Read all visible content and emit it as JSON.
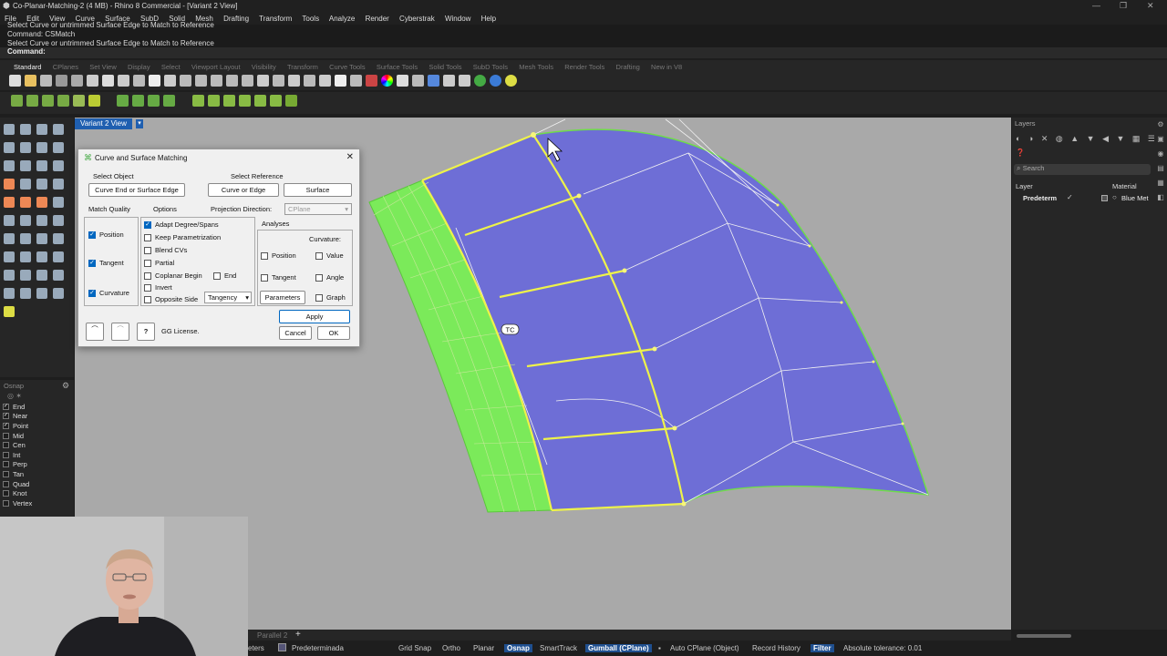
{
  "window": {
    "title": "Co-Planar-Matching-2 (4 MB) - Rhino 8 Commercial - [Variant 2 View]"
  },
  "menu": [
    "File",
    "Edit",
    "View",
    "Curve",
    "Surface",
    "SubD",
    "Solid",
    "Mesh",
    "Drafting",
    "Transform",
    "Tools",
    "Analyze",
    "Render",
    "Cyberstrak",
    "Window",
    "Help"
  ],
  "command_history": {
    "line1": "Select Curve or untrimmed Surface Edge to Match to Reference",
    "line2": "Command: CSMatch",
    "line3": "Select Curve or untrimmed Surface Edge to Match to Reference"
  },
  "command_prompt": "Command:",
  "toolbar_tabs": [
    "Standard",
    "CPlanes",
    "Set View",
    "Display",
    "Select",
    "Viewport Layout",
    "Visibility",
    "Transform",
    "Curve Tools",
    "Surface Tools",
    "Solid Tools",
    "SubD Tools",
    "Mesh Tools",
    "Render Tools",
    "Drafting",
    "New in V8"
  ],
  "viewport": {
    "title": "Variant 2 View",
    "tc_label": "TC"
  },
  "osnap": {
    "header": "Osnap",
    "items": [
      {
        "label": "End",
        "checked": true
      },
      {
        "label": "Near",
        "checked": true
      },
      {
        "label": "Point",
        "checked": true
      },
      {
        "label": "Mid",
        "checked": false
      },
      {
        "label": "Cen",
        "checked": false
      },
      {
        "label": "Int",
        "checked": false
      },
      {
        "label": "Perp",
        "checked": false
      },
      {
        "label": "Tan",
        "checked": false
      },
      {
        "label": "Quad",
        "checked": false
      },
      {
        "label": "Knot",
        "checked": false
      },
      {
        "label": "Vertex",
        "checked": false
      }
    ]
  },
  "dialog": {
    "title": "Curve and Surface Matching",
    "close": "✕",
    "select_object_label": "Select Object",
    "select_object_button": "Curve End or Surface Edge",
    "select_reference_label": "Select Reference",
    "curve_or_edge_button": "Curve or Edge",
    "surface_button": "Surface",
    "match_quality_label": "Match Quality",
    "options_label": "Options",
    "projection_label": "Projection Direction:",
    "projection_value": "CPlane",
    "position": "Position",
    "tangent": "Tangent",
    "curvature": "Curvature",
    "opt_adapt": "Adapt Degree/Spans",
    "opt_keep": "Keep Parametrization",
    "opt_blend": "Blend CVs",
    "opt_partial": "Partial",
    "opt_coplanar": "Coplanar Begin",
    "opt_end": "End",
    "opt_invert": "Invert",
    "opt_opposite": "Opposite Side",
    "tangency_value": "Tangency",
    "analyses_label": "Analyses",
    "an_curvature": "Curvature:",
    "an_position": "Position",
    "an_value": "Value",
    "an_tangent": "Tangent",
    "an_angle": "Angle",
    "an_graph": "Graph",
    "parameters_button": "Parameters",
    "apply_button": "Apply",
    "cancel_button": "Cancel",
    "ok_button": "OK",
    "help_button": "?",
    "license_text": "GG License."
  },
  "layers": {
    "title": "Layers",
    "search_placeholder": "Search",
    "col_layer": "Layer",
    "col_material": "Material",
    "row_layer": "Predeterm",
    "row_material": "Blue Met"
  },
  "viewport_tabs": {
    "tab": "Parallel 2",
    "add": "+"
  },
  "status": {
    "meters": "eters",
    "layer": "Predeterminada",
    "grid_snap": "Grid Snap",
    "ortho": "Ortho",
    "planar": "Planar",
    "osnap": "Osnap",
    "smarttrack": "SmartTrack",
    "gumball": "Gumball (CPlane)",
    "auto_cplane": "Auto CPlane (Object)",
    "record_history": "Record History",
    "filter": "Filter",
    "tolerance": "Absolute tolerance: 0.01"
  }
}
